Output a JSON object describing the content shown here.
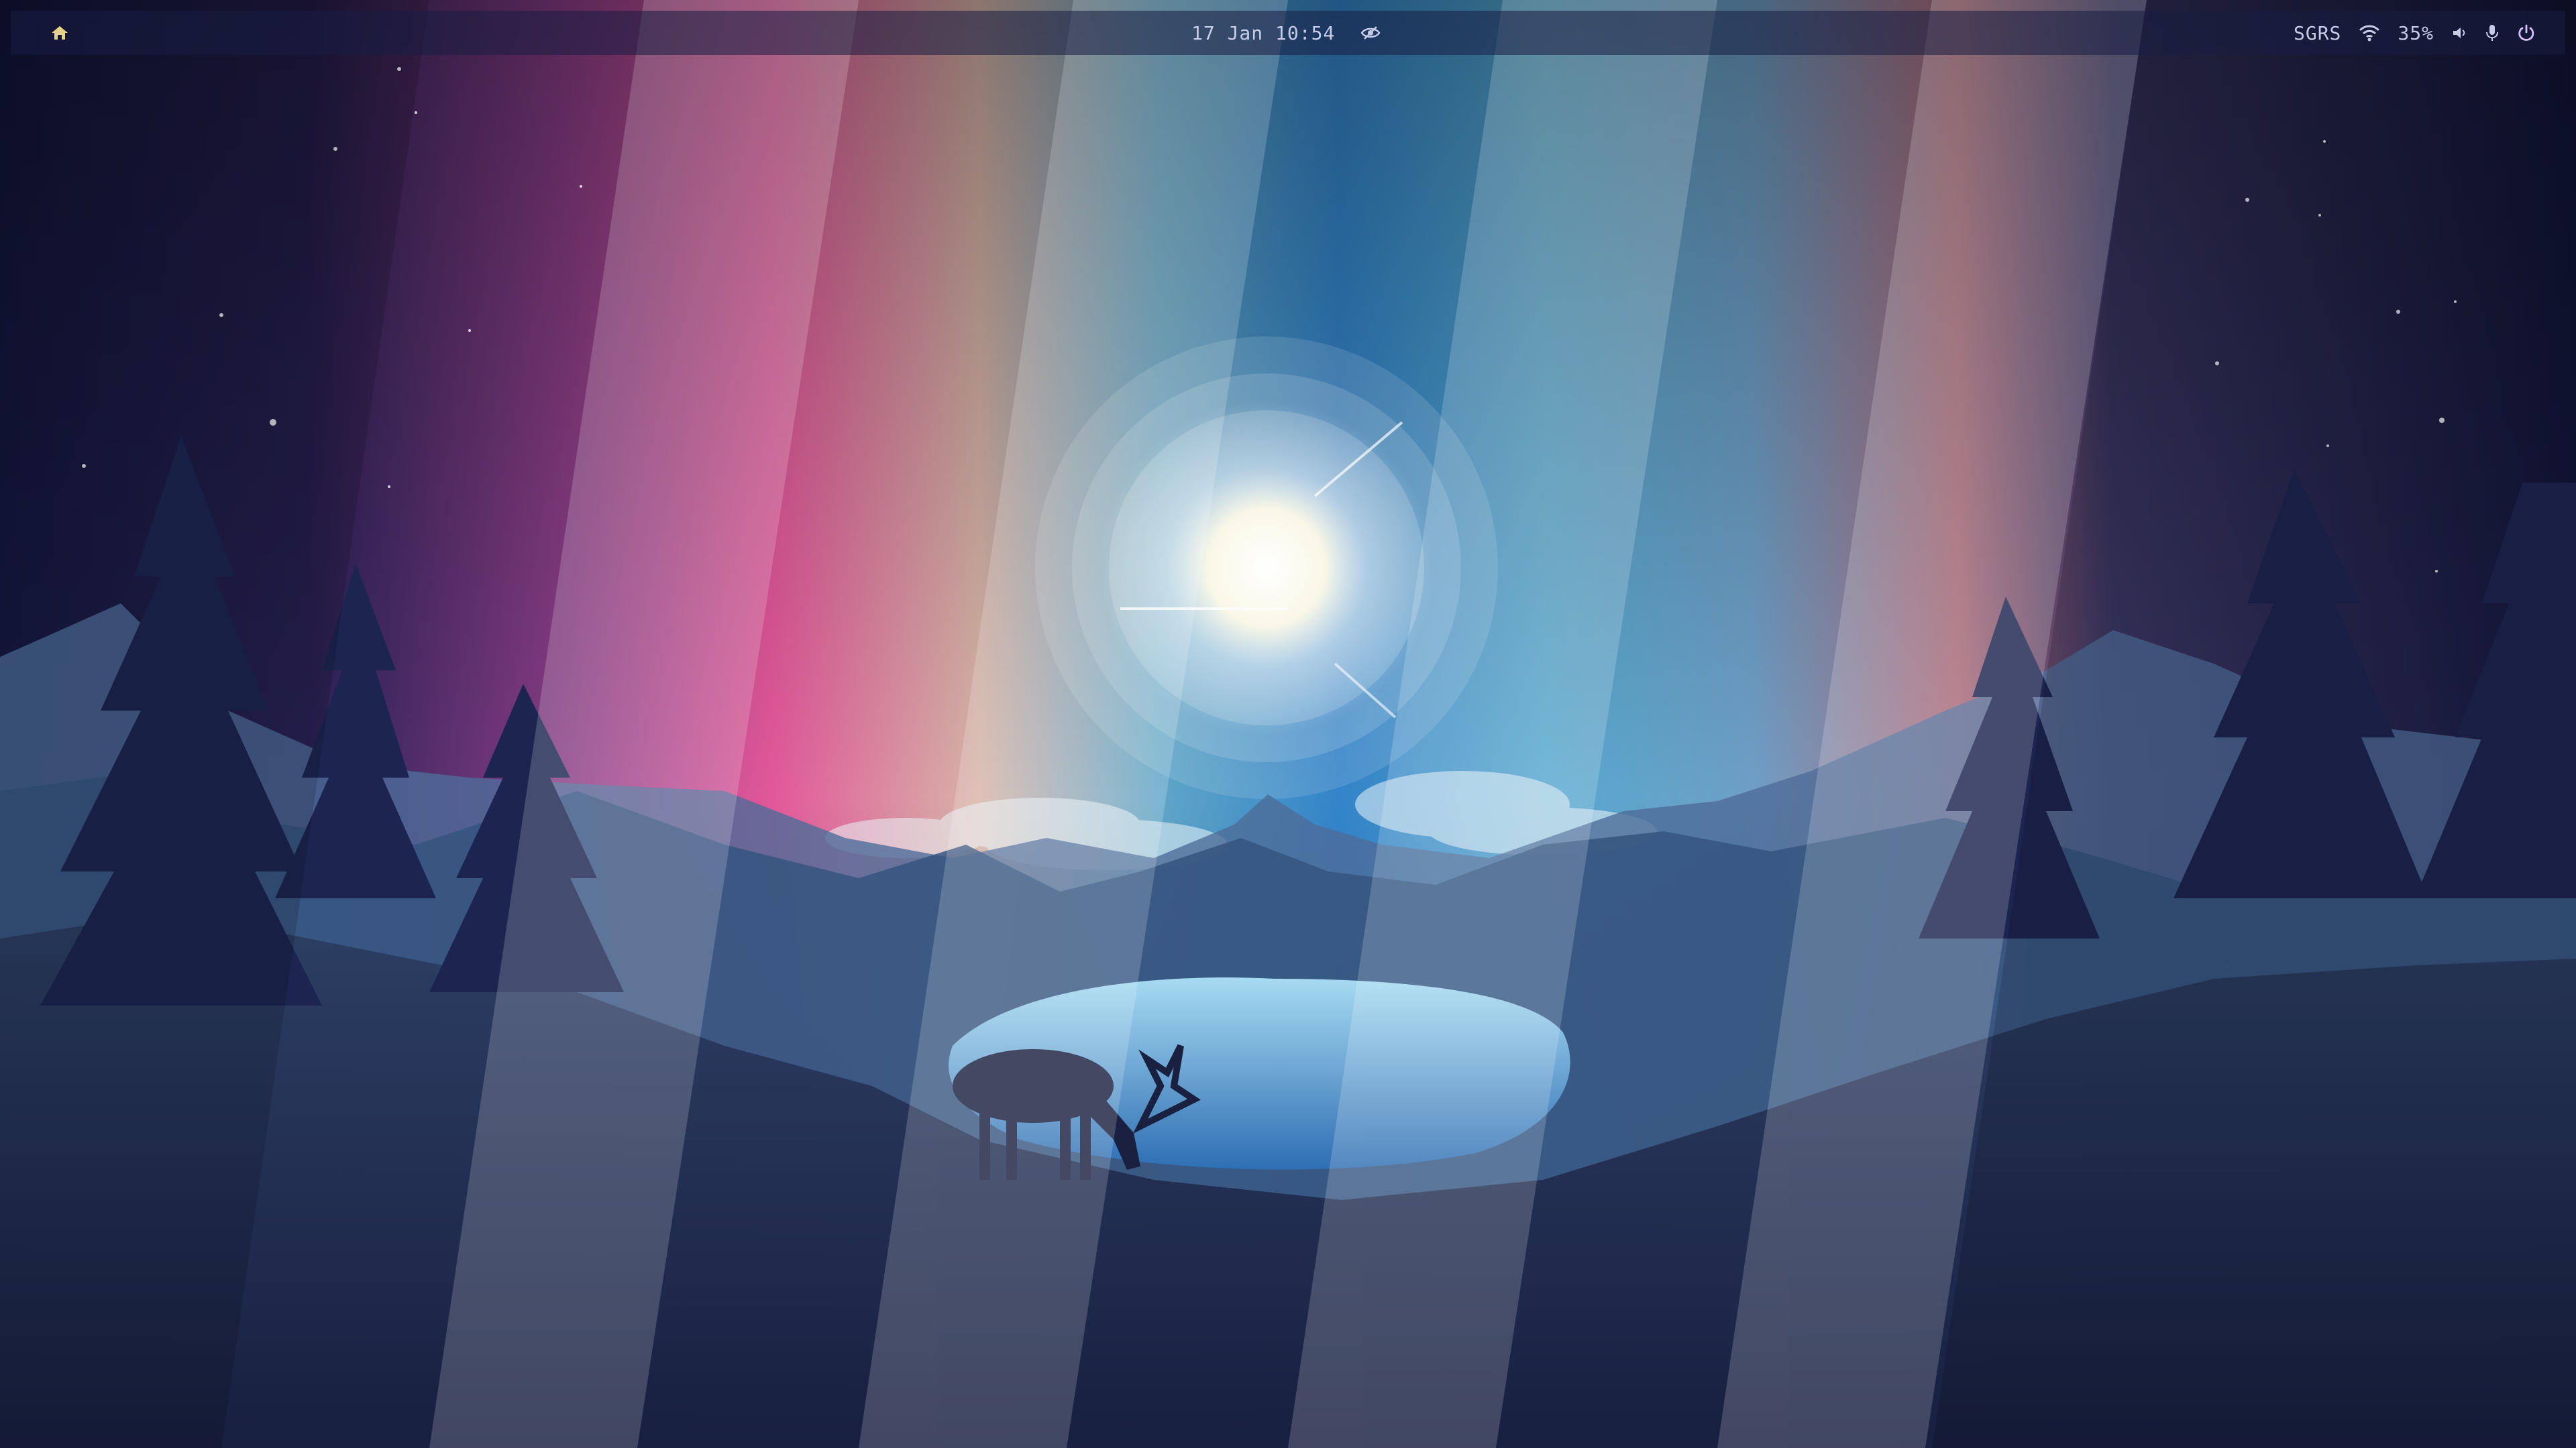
{
  "colors": {
    "bar_background": "#181e42",
    "bar_text": "#c6cbe6",
    "home_icon": "#e8d28a",
    "power_icon": "#d8c0ff",
    "sky_night": "#141843",
    "sky_purple": "#7a3a8a",
    "sky_pink": "#f0559a",
    "sky_teal": "#5fb4cc",
    "sky_blue": "#2e7fc4",
    "sky_orange": "#f07a40",
    "mountain_shadow": "#1f2a52",
    "lake": "#6fc0e8"
  },
  "topbar": {
    "home_icon": "home-icon",
    "datetime": "17 Jan 10:54",
    "visibility_icon": "eye-icon",
    "user": "SGRS",
    "wifi_icon": "wifi-icon",
    "battery": "35%",
    "volume_icon": "volume-icon",
    "mic_icon": "microphone-icon",
    "power_icon": "power-icon"
  },
  "wallpaper": {
    "subject": "deer-by-lake-landscape",
    "sun_icon": "sun-icon"
  }
}
